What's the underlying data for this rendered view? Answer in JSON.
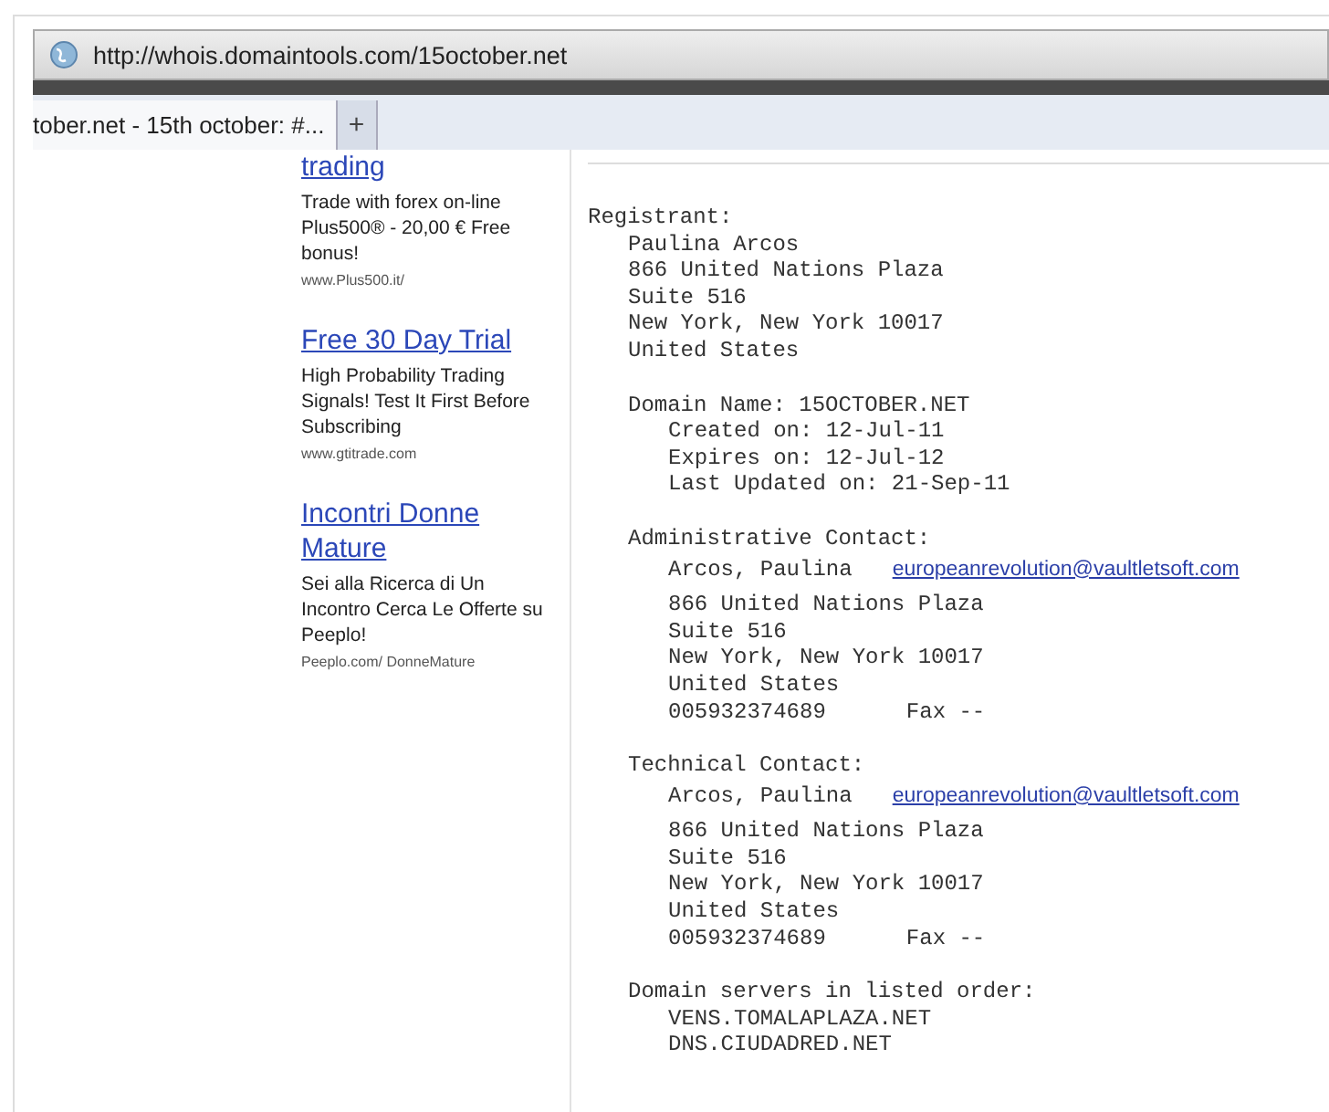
{
  "address_bar": {
    "url": "http://whois.domaintools.com/15october.net"
  },
  "tabs": [
    {
      "label": "tober.net - 15th october: #...",
      "selected": true
    }
  ],
  "new_tab": {
    "label": "+"
  },
  "ads": [
    {
      "title": "trading",
      "description": "Trade with forex on-line Plus500® - 20,00 € Free bonus!",
      "url": "www.Plus500.it/"
    },
    {
      "title": "Free 30 Day Trial",
      "description": "High Probability Trading Signals! Test It First Before Subscribing",
      "url": "www.gtitrade.com"
    },
    {
      "title": "Incontri Donne Mature",
      "description": "Sei alla Ricerca di Un Incontro Cerca Le Offerte su Peeplo!",
      "url": "Peeplo.com/ DonneMature"
    }
  ],
  "whois": {
    "heading": "Registrant:",
    "lines": [
      "Paulina Arcos",
      "866 United Nations Plaza",
      "Suite 516",
      "New York, New York 10017",
      "United States"
    ],
    "sections": [
      {
        "heading": "Domain Name: 15OCTOBER.NET",
        "items": [
          {
            "kind": "text",
            "text": "Created on: 12-Jul-11"
          },
          {
            "kind": "text",
            "text": "Expires on: 12-Jul-12"
          },
          {
            "kind": "text",
            "text": "Last Updated on: 21-Sep-11"
          }
        ]
      },
      {
        "heading": "Administrative Contact:",
        "items": [
          {
            "kind": "contact",
            "name": "Arcos, Paulina",
            "email": "europeanrevolution@vaultletsoft.com"
          },
          {
            "kind": "text",
            "text": "866 United Nations Plaza"
          },
          {
            "kind": "text",
            "text": "Suite 516"
          },
          {
            "kind": "text",
            "text": "New York, New York 10017"
          },
          {
            "kind": "text",
            "text": "United States"
          },
          {
            "kind": "phone",
            "phone": "005932374689",
            "fax": "Fax --"
          }
        ]
      },
      {
        "heading": "Technical Contact:",
        "items": [
          {
            "kind": "contact",
            "name": "Arcos, Paulina",
            "email": "europeanrevolution@vaultletsoft.com"
          },
          {
            "kind": "text",
            "text": "866 United Nations Plaza"
          },
          {
            "kind": "text",
            "text": "Suite 516"
          },
          {
            "kind": "text",
            "text": "New York, New York 10017"
          },
          {
            "kind": "text",
            "text": "United States"
          },
          {
            "kind": "phone",
            "phone": "005932374689",
            "fax": "Fax --"
          }
        ]
      },
      {
        "heading": "Domain servers in listed order:",
        "items": [
          {
            "kind": "text",
            "text": "VENS.TOMALAPLAZA.NET"
          },
          {
            "kind": "text",
            "text": "DNS.CIUDADRED.NET"
          }
        ]
      }
    ]
  }
}
